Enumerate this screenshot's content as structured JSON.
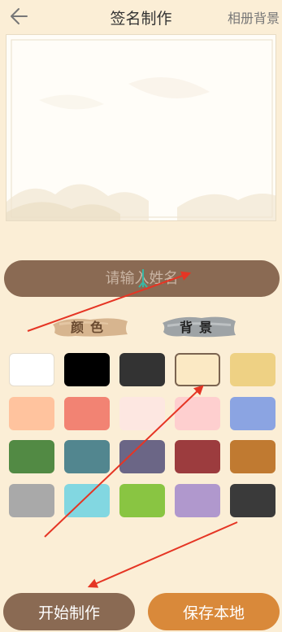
{
  "header": {
    "title": "签名制作",
    "album_label": "相册背景"
  },
  "input": {
    "placeholder": "请输入姓名",
    "value": ""
  },
  "tabs": {
    "color_label": "颜色",
    "background_label": "背景"
  },
  "swatches": [
    "#ffffff",
    "#000000",
    "#333333",
    "#fbe9c4",
    "#eed184",
    "#ffc39e",
    "#f28373",
    "#fde7e1",
    "#fecfcf",
    "#8ba4e2",
    "#528a44",
    "#52868f",
    "#6b6686",
    "#9c3c3e",
    "#c07a31",
    "#a9a9a9",
    "#82d7e1",
    "#89c542",
    "#b098cd",
    "#3a3a3a"
  ],
  "selected_swatch": 3,
  "buttons": {
    "start_label": "开始制作",
    "save_label": "保存本地"
  },
  "colors": {
    "background": "#fbeed6",
    "primary_brown": "#8a6a53",
    "accent_orange": "#d9893a",
    "annotation_red": "#e53524"
  }
}
